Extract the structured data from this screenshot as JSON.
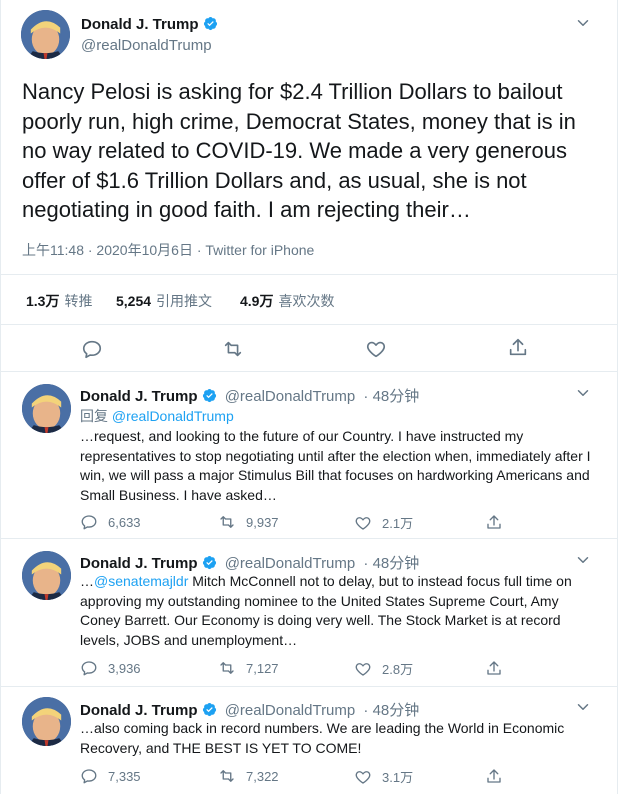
{
  "colors": {
    "accent": "#1da1f2",
    "muted": "#657786",
    "text": "#14171a",
    "border": "#e6ecf0"
  },
  "main_tweet": {
    "name": "Donald J. Trump",
    "handle": "@realDonaldTrump",
    "text": "Nancy Pelosi is asking for $2.4 Trillion Dollars to bailout poorly run, high crime, Democrat States, money that is in no way related to COVID-19. We made a very generous offer of $1.6 Trillion Dollars and, as usual, she is not negotiating in good faith. I am rejecting their…",
    "time": "上午11:48 · 2020年10月6日 · ",
    "source": "Twitter for iPhone",
    "stats": {
      "retweets_value": "1.3万",
      "retweets_label": "转推",
      "quotes_value": "5,254",
      "quotes_label": "引用推文",
      "likes_value": "4.9万",
      "likes_label": "喜欢次数"
    },
    "icons": [
      "reply-icon",
      "retweet-icon",
      "like-icon",
      "share-icon"
    ]
  },
  "replies": [
    {
      "name": "Donald J. Trump",
      "handle": "@realDonaldTrump",
      "time": "· 48分钟",
      "reply_to_prefix": "回复 ",
      "reply_to_handle": "@realDonaldTrump",
      "text": "…request, and looking to the future of our Country. I have instructed my representatives to stop negotiating until after the election when, immediately after I win, we will pass a major Stimulus Bill that focuses on hardworking Americans and Small Business. I have asked…",
      "reply_count": "6,633",
      "retweet_count": "9,937",
      "like_count": "2.1万"
    },
    {
      "name": "Donald J. Trump",
      "handle": "@realDonaldTrump",
      "time": "· 48分钟",
      "text_prefix": "…",
      "mention": "@senatemajldr",
      "text": " Mitch McConnell not to delay, but to instead focus full time on approving my outstanding nominee to the United States Supreme Court, Amy Coney Barrett. Our Economy is doing very well. The Stock Market is at record levels, JOBS and unemployment…",
      "reply_count": "3,936",
      "retweet_count": "7,127",
      "like_count": "2.8万"
    },
    {
      "name": "Donald J. Trump",
      "handle": "@realDonaldTrump",
      "time": "· 48分钟",
      "text": "…also coming back in record numbers. We are leading the World in Economic Recovery, and THE BEST IS YET TO COME!",
      "reply_count": "7,335",
      "retweet_count": "7,322",
      "like_count": "3.1万"
    }
  ]
}
